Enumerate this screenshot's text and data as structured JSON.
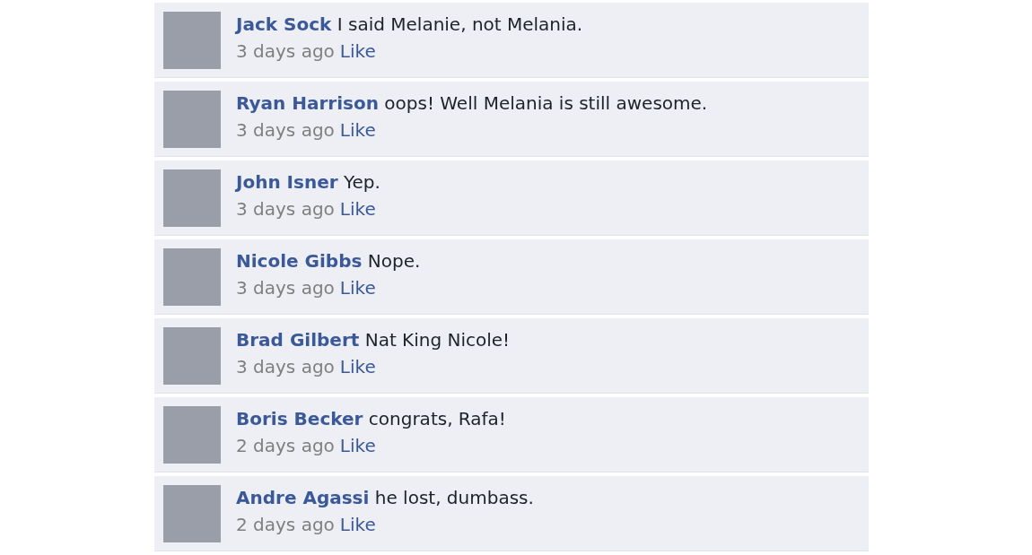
{
  "comments": [
    {
      "author": "Jack Sock",
      "text": "I said Melanie, not Melania.",
      "time": "3 days ago",
      "action": "Like"
    },
    {
      "author": "Ryan Harrison",
      "text": "oops! Well Melania is still awesome.",
      "time": "3 days ago",
      "action": "Like"
    },
    {
      "author": "John Isner",
      "text": "Yep.",
      "time": "3 days ago",
      "action": "Like"
    },
    {
      "author": "Nicole Gibbs",
      "text": "Nope.",
      "time": "3 days ago",
      "action": "Like"
    },
    {
      "author": "Brad Gilbert",
      "text": "Nat King Nicole!",
      "time": "3 days ago",
      "action": "Like"
    },
    {
      "author": "Boris Becker",
      "text": "congrats, Rafa!",
      "time": "2 days ago",
      "action": "Like"
    },
    {
      "author": "Andre Agassi",
      "text": "he lost, dumbass.",
      "time": "2 days ago",
      "action": "Like"
    }
  ]
}
